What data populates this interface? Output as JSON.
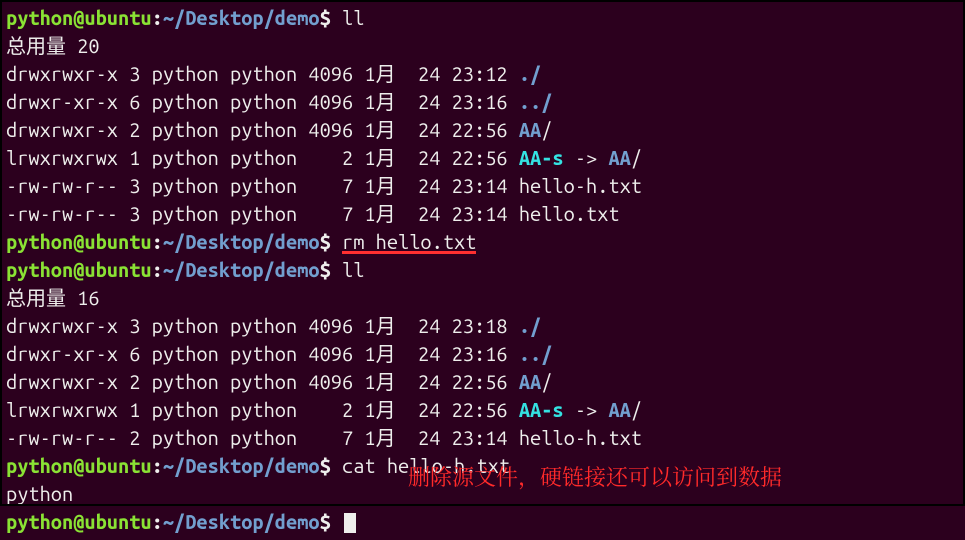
{
  "prompt": {
    "user": "python",
    "host": "ubuntu",
    "path": "~/Desktop/demo",
    "sigil": "$"
  },
  "commands": {
    "cmd1": "ll",
    "cmd2_prefix": "rm ",
    "cmd2_arg": "hello.txt",
    "cmd3": "ll",
    "cmd4": "cat hello-h.txt",
    "cat_output": "python"
  },
  "listing1": {
    "header": "总用量 20",
    "entries": [
      {
        "perm": "drwxrwxr-x",
        "links": "3",
        "owner": "python",
        "group": "python",
        "size": "4096",
        "month": "1月",
        "day": "24",
        "time": "23:12",
        "name": "./",
        "kind": "dir"
      },
      {
        "perm": "drwxr-xr-x",
        "links": "6",
        "owner": "python",
        "group": "python",
        "size": "4096",
        "month": "1月",
        "day": "24",
        "time": "23:16",
        "name": "../",
        "kind": "dir"
      },
      {
        "perm": "drwxrwxr-x",
        "links": "2",
        "owner": "python",
        "group": "python",
        "size": "4096",
        "month": "1月",
        "day": "24",
        "time": "22:56",
        "name": "AA",
        "kind": "dir",
        "slash": "/"
      },
      {
        "perm": "lrwxrwxrwx",
        "links": "1",
        "owner": "python",
        "group": "python",
        "size": "2",
        "month": "1月",
        "day": "24",
        "time": "22:56",
        "name": "AA-s",
        "kind": "sym",
        "target": "AA",
        "target_kind": "dir",
        "target_slash": "/"
      },
      {
        "perm": "-rw-rw-r--",
        "links": "3",
        "owner": "python",
        "group": "python",
        "size": "7",
        "month": "1月",
        "day": "24",
        "time": "23:14",
        "name": "hello-h.txt",
        "kind": "file"
      },
      {
        "perm": "-rw-rw-r--",
        "links": "3",
        "owner": "python",
        "group": "python",
        "size": "7",
        "month": "1月",
        "day": "24",
        "time": "23:14",
        "name": "hello.txt",
        "kind": "file"
      }
    ]
  },
  "listing2": {
    "header": "总用量 16",
    "entries": [
      {
        "perm": "drwxrwxr-x",
        "links": "3",
        "owner": "python",
        "group": "python",
        "size": "4096",
        "month": "1月",
        "day": "24",
        "time": "23:18",
        "name": "./",
        "kind": "dir"
      },
      {
        "perm": "drwxr-xr-x",
        "links": "6",
        "owner": "python",
        "group": "python",
        "size": "4096",
        "month": "1月",
        "day": "24",
        "time": "23:16",
        "name": "../",
        "kind": "dir"
      },
      {
        "perm": "drwxrwxr-x",
        "links": "2",
        "owner": "python",
        "group": "python",
        "size": "4096",
        "month": "1月",
        "day": "24",
        "time": "22:56",
        "name": "AA",
        "kind": "dir",
        "slash": "/"
      },
      {
        "perm": "lrwxrwxrwx",
        "links": "1",
        "owner": "python",
        "group": "python",
        "size": "2",
        "month": "1月",
        "day": "24",
        "time": "22:56",
        "name": "AA-s",
        "kind": "sym",
        "target": "AA",
        "target_kind": "dir",
        "target_slash": "/"
      },
      {
        "perm": "-rw-rw-r--",
        "links": "2",
        "owner": "python",
        "group": "python",
        "size": "7",
        "month": "1月",
        "day": "24",
        "time": "23:14",
        "name": "hello-h.txt",
        "kind": "file"
      }
    ]
  },
  "annotation": "删除源文件，硬链接还可以访问到数据",
  "colors": {
    "bg": "#2c001e",
    "fg": "#eeeeec",
    "green": "#8ae234",
    "blue": "#729fcf",
    "cyan": "#34e2e2",
    "red": "#ff2a2a"
  }
}
